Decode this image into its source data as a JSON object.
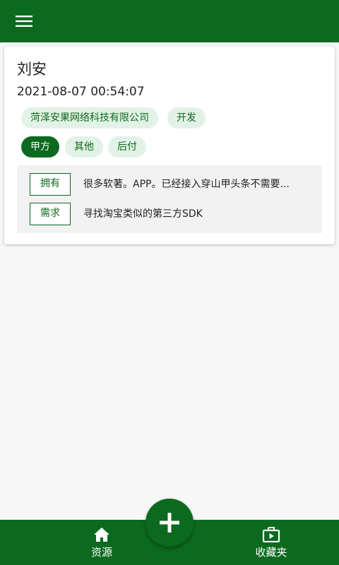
{
  "appbar": {
    "menu_icon": "menu-icon",
    "color": "#0c6a1f"
  },
  "card": {
    "name": "刘安",
    "datetime": "2021-08-07 00:54:07",
    "tags_row1": [
      "菏泽安果网络科技有限公司",
      "开发"
    ],
    "tags_row2": [
      "甲方",
      "其他",
      "后付"
    ],
    "have_label": "拥有",
    "have_text": "很多软著。APP。已经接入穿山甲头条不需要...",
    "need_label": "需求",
    "need_text": "寻找淘宝类似的第三方SDK"
  },
  "bottom_nav": {
    "items": [
      {
        "label": "资源",
        "icon": "home-icon"
      },
      {
        "label": "收藏夹",
        "icon": "video-folder-icon"
      }
    ],
    "fab_icon": "plus-icon"
  },
  "colors": {
    "primary": "#0c6a1f",
    "chip_bg": "#e3f2e6",
    "info_bg": "#f2f2f2"
  }
}
